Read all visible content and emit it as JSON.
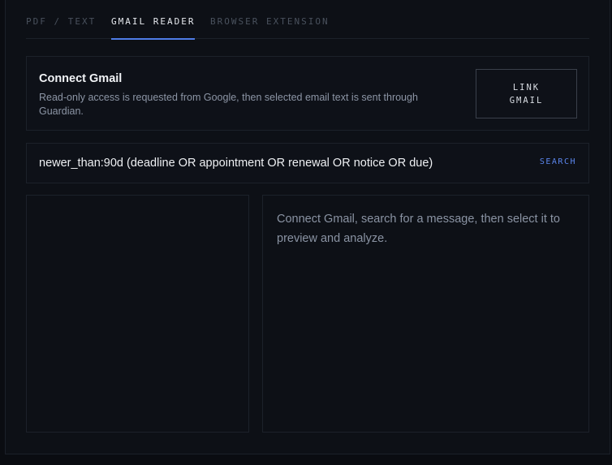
{
  "tabs": [
    {
      "label": "PDF / TEXT",
      "active": false
    },
    {
      "label": "GMAIL READER",
      "active": true
    },
    {
      "label": "BROWSER EXTENSION",
      "active": false
    }
  ],
  "connect": {
    "title": "Connect Gmail",
    "description": "Read-only access is requested from Google, then selected email text is sent through Guardian.",
    "button_line1": "LINK",
    "button_line2": "GMAIL"
  },
  "search": {
    "query": "newer_than:90d (deadline OR appointment OR renewal OR notice OR due)",
    "button_label": "SEARCH"
  },
  "preview": {
    "empty_message": "Connect Gmail, search for a message, then select it to preview and analyze."
  },
  "colors": {
    "accent": "#4f7ce6",
    "background": "#0d1016",
    "border": "#1c212a"
  }
}
